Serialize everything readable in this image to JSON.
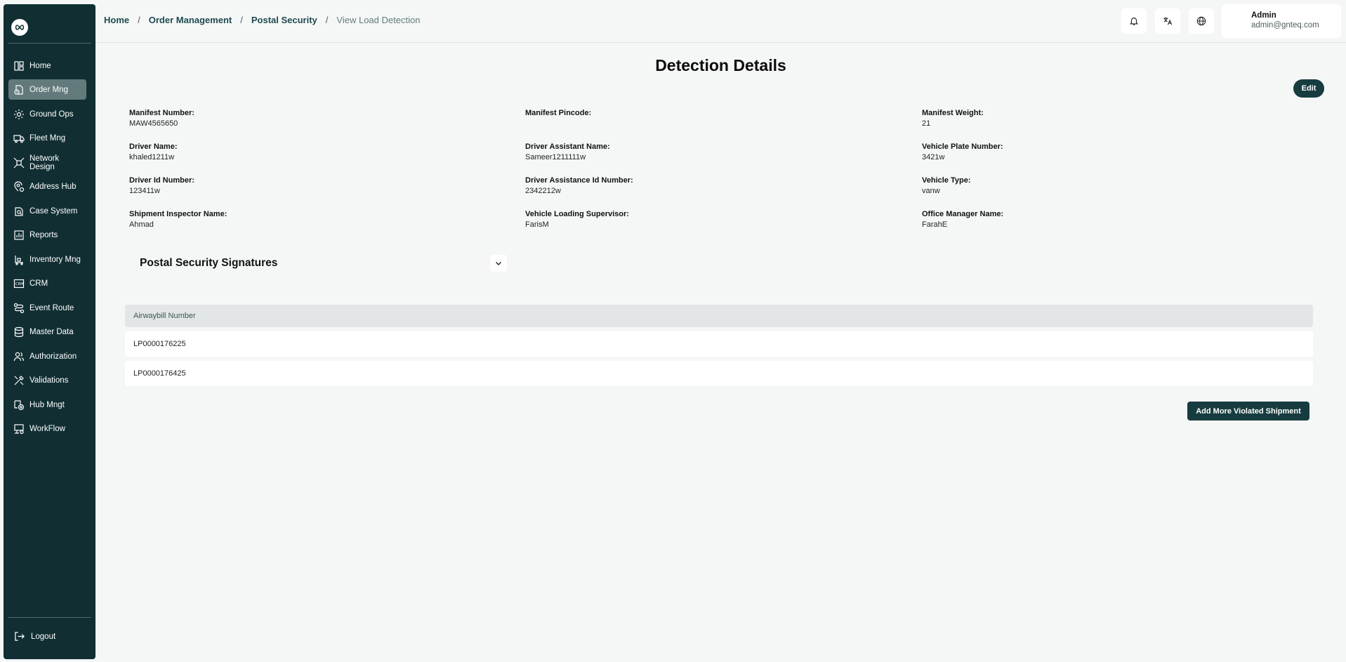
{
  "sidebar": {
    "items": [
      {
        "label": "Home",
        "icon": "home-icon"
      },
      {
        "label": "Order Mng",
        "icon": "order-icon",
        "active": true
      },
      {
        "label": "Ground Ops",
        "icon": "ground-ops-icon"
      },
      {
        "label": "Fleet Mng",
        "icon": "truck-icon"
      },
      {
        "label": "Network Design",
        "icon": "network-icon"
      },
      {
        "label": "Address Hub",
        "icon": "address-icon"
      },
      {
        "label": "Case System",
        "icon": "case-icon"
      },
      {
        "label": "Reports",
        "icon": "reports-icon"
      },
      {
        "label": "Inventory Mng",
        "icon": "inventory-icon"
      },
      {
        "label": "CRM",
        "icon": "crm-icon"
      },
      {
        "label": "Event Route",
        "icon": "route-icon"
      },
      {
        "label": "Master Data",
        "icon": "database-icon"
      },
      {
        "label": "Authorization",
        "icon": "users-icon"
      },
      {
        "label": "Validations",
        "icon": "validations-icon"
      },
      {
        "label": "Hub Mngt",
        "icon": "hub-icon"
      },
      {
        "label": "WorkFlow",
        "icon": "workflow-icon"
      }
    ],
    "logout_label": "Logout"
  },
  "breadcrumb": {
    "items": [
      "Home",
      "Order Management",
      "Postal Security"
    ],
    "current": "View Load Detection"
  },
  "user": {
    "name": "Admin",
    "email": "admin@gnteq.com"
  },
  "page": {
    "title": "Detection Details",
    "edit_label": "Edit"
  },
  "fields": [
    {
      "label": "Manifest Number:",
      "value": "MAW4565650"
    },
    {
      "label": "Manifest Pincode:",
      "value": ""
    },
    {
      "label": "Manifest Weight:",
      "value": "21"
    },
    {
      "label": "Driver Name:",
      "value": "khaled1211w"
    },
    {
      "label": "Driver Assistant Name:",
      "value": "Sameer1211111w"
    },
    {
      "label": "Vehicle Plate Number:",
      "value": "3421w"
    },
    {
      "label": "Driver Id Number:",
      "value": "123411w"
    },
    {
      "label": "Driver Assistance Id Number:",
      "value": "2342212w"
    },
    {
      "label": "Vehicle Type:",
      "value": "vanw"
    },
    {
      "label": "Shipment Inspector Name:",
      "value": "Ahmad"
    },
    {
      "label": "Vehicle Loading Supervisor:",
      "value": "FarisM"
    },
    {
      "label": "Office Manager Name:",
      "value": "FarahE"
    }
  ],
  "signatures": {
    "title": "Postal Security Signatures"
  },
  "table": {
    "header": "Airwaybill Number",
    "rows": [
      "LP0000176225",
      "LP0000176425"
    ]
  },
  "actions": {
    "add_label": "Add More Violated Shipment"
  },
  "colors": {
    "sidebar_bg": "#112f33",
    "active_item": "#627a7c",
    "primary_button": "#173c40",
    "page_bg": "#f5f7f7"
  }
}
